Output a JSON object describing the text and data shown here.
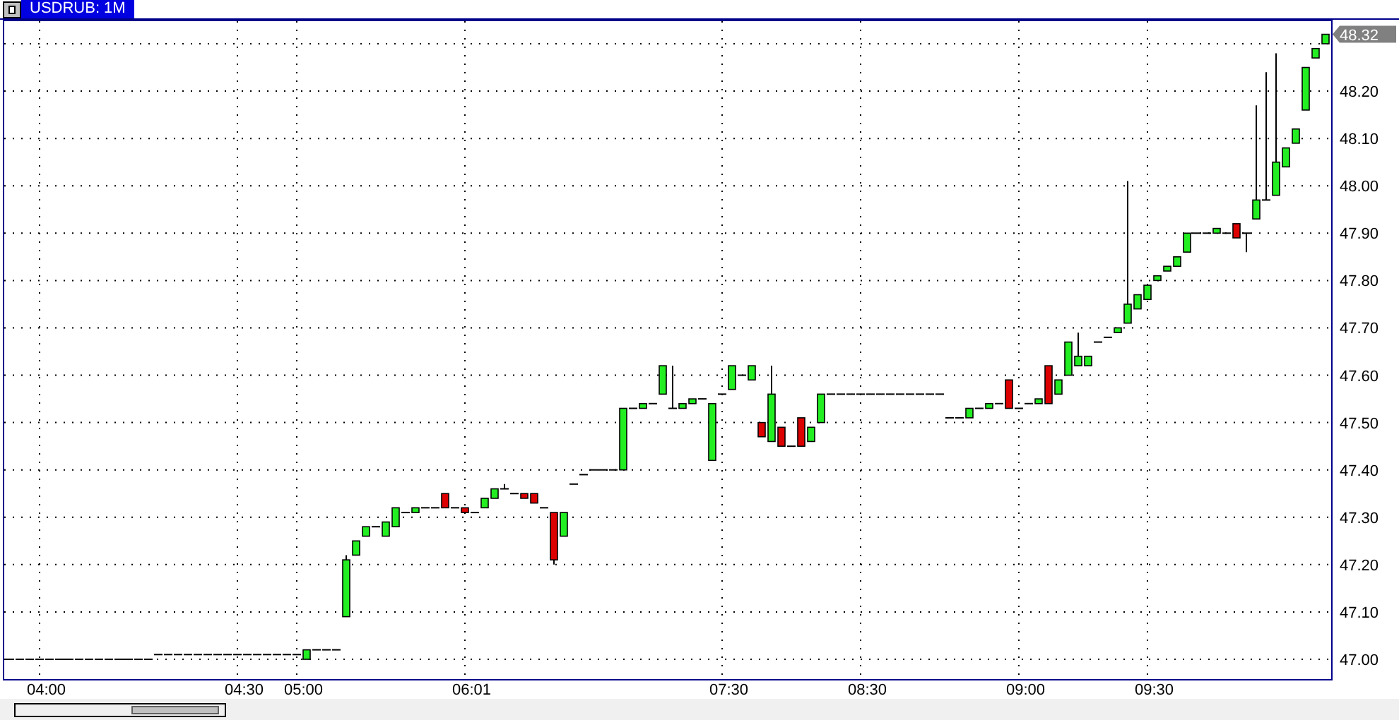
{
  "window": {
    "tab": {
      "label": "USDRUB: 1M",
      "selected": true
    }
  },
  "chart": {
    "last_price": "48.32",
    "price_labels": [
      "48.20",
      "48.10",
      "48.00",
      "47.90",
      "47.80",
      "47.70",
      "47.60",
      "47.50",
      "47.40",
      "47.30",
      "47.20",
      "47.10",
      "47.00"
    ],
    "time_labels": [
      "04:00",
      "04:30",
      "05:00",
      "06:01",
      "07:30",
      "08:30",
      "09:00",
      "09:30"
    ]
  }
}
